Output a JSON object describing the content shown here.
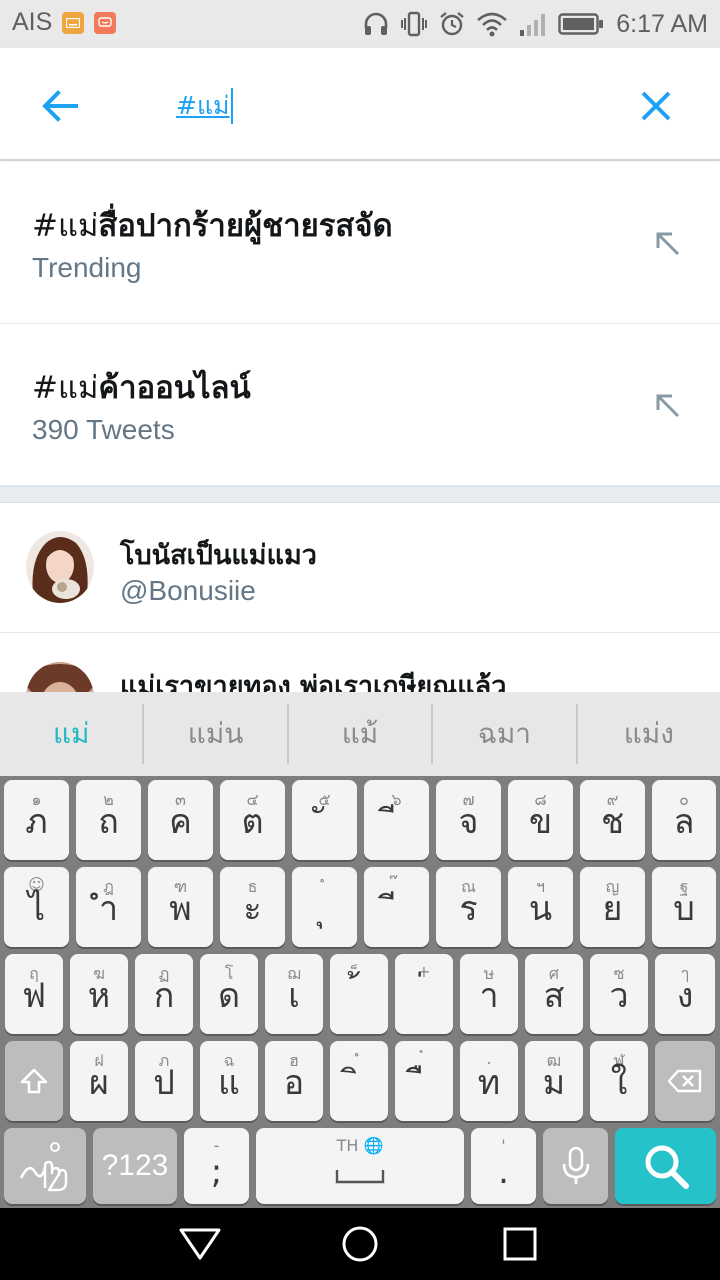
{
  "status_bar": {
    "carrier": "AIS",
    "time": "6:17 AM",
    "icons": [
      "keyboard-notification-icon",
      "message-notification-icon",
      "headphones-icon",
      "vibrate-icon",
      "alarm-icon",
      "wifi-icon",
      "cell-signal-icon",
      "battery-icon"
    ]
  },
  "search": {
    "query": "#แม่",
    "back_icon": "arrow-left-icon",
    "clear_icon": "close-icon",
    "accent_color": "#1da1f2"
  },
  "suggestions": [
    {
      "prefix": "#แม่",
      "rest": "สื่อปากร้ายผู้ชายรสจัด",
      "sub": "Trending",
      "icon": "fill-query-arrow-icon"
    },
    {
      "prefix": "#แม่",
      "rest": "ค้าออนไลน์",
      "sub": "390 Tweets",
      "icon": "fill-query-arrow-icon"
    }
  ],
  "users": [
    {
      "name": "โบนัสเป็นแม่แมว",
      "handle": "@Bonusiie"
    },
    {
      "name": "แม่เราขายทอง พ่อเราเกษียณแล้ว",
      "handle": ""
    }
  ],
  "keyboard": {
    "candidates": [
      "แม่",
      "แม่น",
      "แม้",
      "ฉมา",
      "แม่ง"
    ],
    "selected_candidate": "แม่",
    "row1": [
      {
        "hint": "๑",
        "main": "ภ"
      },
      {
        "hint": "๒",
        "main": "ถ"
      },
      {
        "hint": "๓",
        "main": "ค"
      },
      {
        "hint": "๔",
        "main": "ต"
      },
      {
        "hint": "๕",
        "main": "ั"
      },
      {
        "hint": "๖",
        "main": "ี"
      },
      {
        "hint": "๗",
        "main": "จ"
      },
      {
        "hint": "๘",
        "main": "ข"
      },
      {
        "hint": "๙",
        "main": "ช"
      },
      {
        "hint": "๐",
        "main": "ล"
      }
    ],
    "row2": [
      {
        "hint": "☺",
        "main": "ไ"
      },
      {
        "hint": "ฎ",
        "main": "ำ"
      },
      {
        "hint": "ฑ",
        "main": "พ"
      },
      {
        "hint": "ธ",
        "main": "ะ"
      },
      {
        "hint": "ํ",
        "main": "ุ"
      },
      {
        "hint": "๊",
        "main": "ี"
      },
      {
        "hint": "ณ",
        "main": "ร"
      },
      {
        "hint": "ฯ",
        "main": "น"
      },
      {
        "hint": "ญ",
        "main": "ย"
      },
      {
        "hint": "ฐ",
        "main": "บ"
      }
    ],
    "row3": [
      {
        "hint": "ฤ",
        "main": "ฟ"
      },
      {
        "hint": "ฆ",
        "main": "ห"
      },
      {
        "hint": "ฏ",
        "main": "ก"
      },
      {
        "hint": "โ",
        "main": "ด"
      },
      {
        "hint": "ฌ",
        "main": "เ"
      },
      {
        "hint": "็",
        "main": "้"
      },
      {
        "hint": "+",
        "main": "่"
      },
      {
        "hint": "ษ",
        "main": "า"
      },
      {
        "hint": "ศ",
        "main": "ส"
      },
      {
        "hint": "ซ",
        "main": "ว"
      },
      {
        "hint": "ๅ",
        "main": "ง"
      }
    ],
    "row4": [
      {
        "hint": "ฝ",
        "main": "ผ"
      },
      {
        "hint": "ภ",
        "main": "ป"
      },
      {
        "hint": "ฉ",
        "main": "แ"
      },
      {
        "hint": "ฮ",
        "main": "อ"
      },
      {
        "hint": "ํ",
        "main": "ิ"
      },
      {
        "hint": "๋",
        "main": "ื"
      },
      {
        "hint": ".",
        "main": "ท"
      },
      {
        "hint": "ฒ",
        "main": "ม"
      },
      {
        "hint": "ฬ",
        "main": "ใ"
      }
    ],
    "row5": {
      "symbols_label": "?123",
      "punct_hint": "-",
      "punct_main": ";",
      "space_label": "TH",
      "period_hint": "'",
      "period_main": "."
    }
  },
  "nav_bar": {
    "icons": [
      "back-triangle-icon",
      "home-circle-icon",
      "recents-square-icon"
    ]
  }
}
